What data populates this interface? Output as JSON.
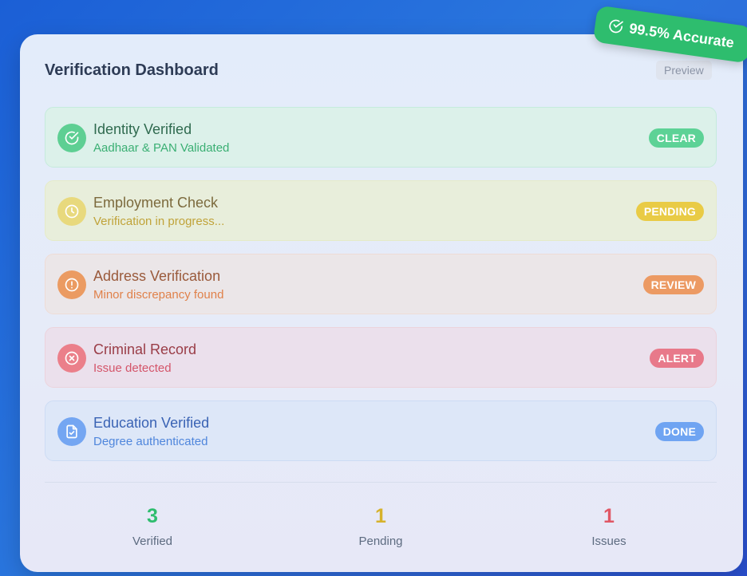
{
  "dashboard": {
    "title": "Verification Dashboard",
    "preview_label": "Preview",
    "accuracy_badge": "99.5% Accurate"
  },
  "checks": [
    {
      "name": "Identity Verified",
      "detail": "Aadhaar & PAN Validated",
      "status": "CLEAR",
      "icon": "check-circle-icon",
      "color": "#2ebd6e"
    },
    {
      "name": "Employment Check",
      "detail": "Verification in progress...",
      "status": "PENDING",
      "icon": "clock-icon",
      "color": "#e4c139"
    },
    {
      "name": "Address Verification",
      "detail": "Minor discrepancy found",
      "status": "REVIEW",
      "icon": "alert-circle-icon",
      "color": "#e88d4f"
    },
    {
      "name": "Criminal Record",
      "detail": "Issue detected",
      "status": "ALERT",
      "icon": "x-circle-icon",
      "color": "#e5707c"
    },
    {
      "name": "Education Verified",
      "detail": "Degree authenticated",
      "status": "DONE",
      "icon": "document-check-icon",
      "color": "#5b9af0"
    }
  ],
  "summary": {
    "verified": {
      "value": "3",
      "label": "Verified",
      "color": "#2ebd6e"
    },
    "pending": {
      "value": "1",
      "label": "Pending",
      "color": "#d6b22c"
    },
    "issues": {
      "value": "1",
      "label": "Issues",
      "color": "#e05765"
    }
  }
}
